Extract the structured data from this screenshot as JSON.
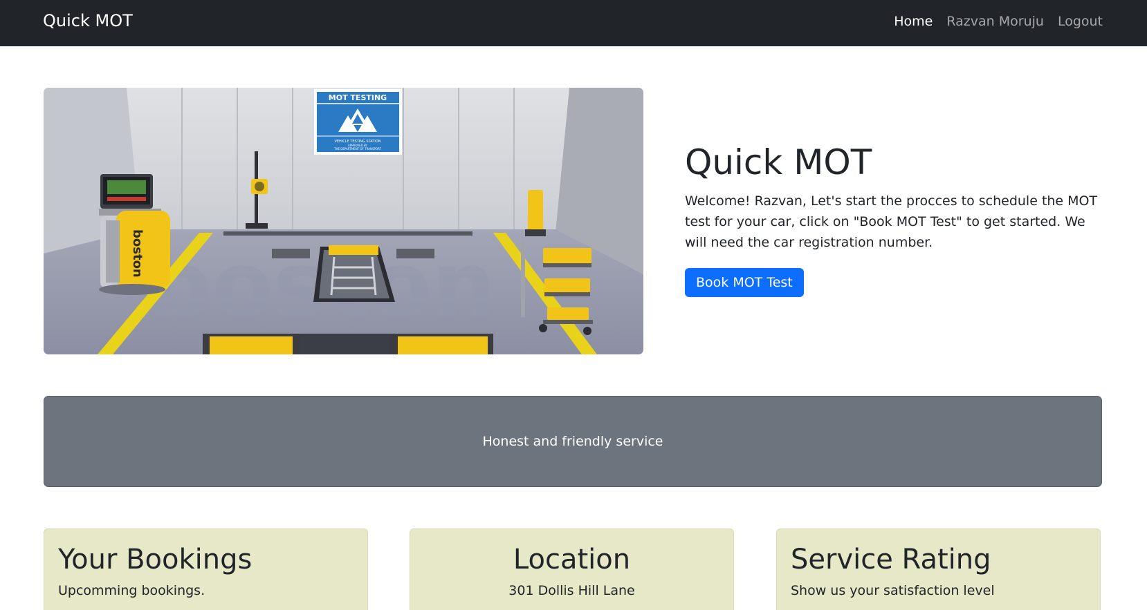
{
  "navbar": {
    "brand": "Quick MOT",
    "links": [
      {
        "label": "Home",
        "active": true
      },
      {
        "label": "Razvan Moruju",
        "active": false
      },
      {
        "label": "Logout",
        "active": false
      }
    ]
  },
  "hero": {
    "image": {
      "sign_title": "MOT TESTING",
      "sign_subtitle": "VEHICLE TESTING STATION",
      "sign_line2": "APPROVED BY",
      "sign_line3": "THE DEPARTMENT OF TRANSPORT",
      "machine_brand": "boston",
      "floor_watermark": "boston"
    },
    "title": "Quick MOT",
    "lead": "Welcome! Razvan, Let's start the procces to schedule the MOT test for your car, click on \"Book MOT Test\" to get started. We will need the car registration number.",
    "button_label": "Book MOT Test"
  },
  "banner": {
    "text": "Honest and friendly service"
  },
  "cards": [
    {
      "title": "Your Bookings",
      "text": "Upcomming bookings."
    },
    {
      "title": "Location",
      "text": "301 Dollis Hill Lane"
    },
    {
      "title": "Service Rating",
      "text": "Show us your satisfaction level"
    }
  ],
  "colors": {
    "navbar": "#212529",
    "primary": "#0d6efd",
    "banner": "#6c757d",
    "card": "#e6e8c8",
    "sign_blue": "#2a7ac4",
    "equipment_yellow": "#f2c417"
  }
}
